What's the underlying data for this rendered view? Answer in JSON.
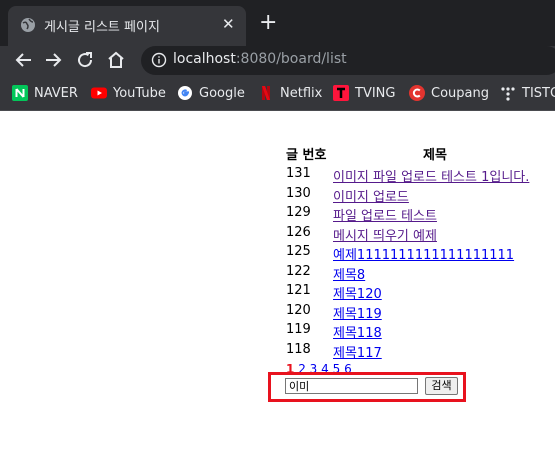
{
  "browser": {
    "tab_title": "게시글 리스트 페이지",
    "close_glyph": "✕",
    "new_tab_glyph": "+",
    "url_host": "localhost",
    "url_rest": ":8080/board/list"
  },
  "bookmarks": [
    {
      "label": "NAVER",
      "color": "#03c75a",
      "icon": "naver-icon"
    },
    {
      "label": "YouTube",
      "color": "#ff0000",
      "icon": "youtube-icon"
    },
    {
      "label": "Google",
      "color": "#4285f4",
      "icon": "google-icon"
    },
    {
      "label": "Netflix",
      "color": "#e50914",
      "icon": "netflix-icon"
    },
    {
      "label": "TVING",
      "color": "#ff153c",
      "icon": "tving-icon"
    },
    {
      "label": "Coupang",
      "color": "#e3342f",
      "icon": "coupang-icon"
    },
    {
      "label": "TISTO",
      "color": "#e8eaed",
      "icon": "tistory-icon"
    }
  ],
  "board": {
    "col_no": "글 번호",
    "col_title": "제목",
    "posts": [
      {
        "no": "131",
        "title": "이미지 파일 업로드 테스트 1입니다."
      },
      {
        "no": "130",
        "title": "이미지 업로드"
      },
      {
        "no": "129",
        "title": "파일 업로드 테스트"
      },
      {
        "no": "126",
        "title": "메시지 띄우기 예제"
      },
      {
        "no": "125",
        "title": "예제1111111111111111111"
      },
      {
        "no": "122",
        "title": "제목8"
      },
      {
        "no": "121",
        "title": "제목120"
      },
      {
        "no": "120",
        "title": "제목119"
      },
      {
        "no": "119",
        "title": "제목118"
      },
      {
        "no": "118",
        "title": "제목117"
      }
    ],
    "pages": [
      "1",
      "2",
      "3",
      "4",
      "5",
      "6"
    ],
    "current_page": "1"
  },
  "search": {
    "value": "이미",
    "button_label": "검색"
  },
  "colors": {
    "highlight_box": "#e8121e",
    "link_visited": "#551a8b",
    "link": "#0000ee"
  }
}
